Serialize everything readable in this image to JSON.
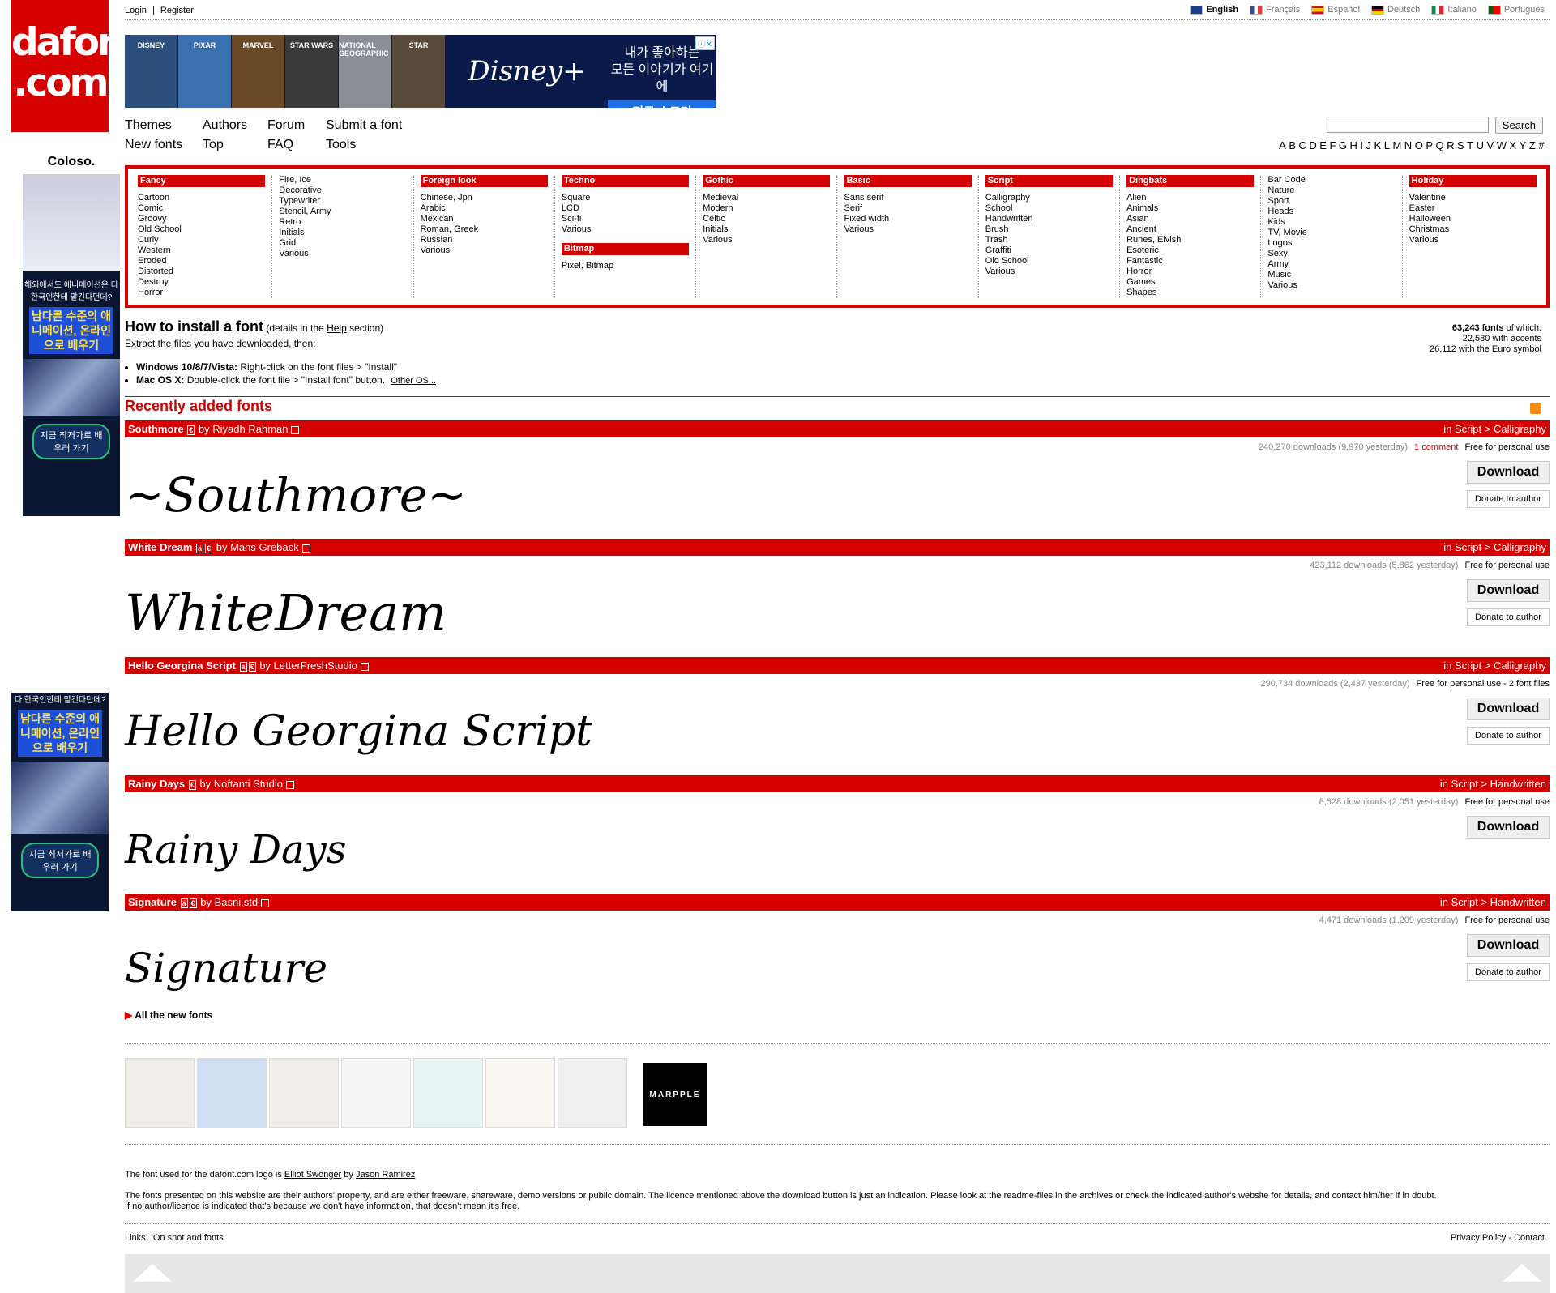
{
  "logo": {
    "line1": "dafont",
    "line2": ".com"
  },
  "top_links": {
    "login": "Login",
    "sep": "|",
    "register": "Register"
  },
  "languages": [
    {
      "label": "English",
      "active": true
    },
    {
      "label": "Français",
      "active": false
    },
    {
      "label": "Español",
      "active": false
    },
    {
      "label": "Deutsch",
      "active": false
    },
    {
      "label": "Italiano",
      "active": false
    },
    {
      "label": "Português",
      "active": false
    }
  ],
  "top_ad": {
    "posters": [
      "DISNEY",
      "PIXAR",
      "MARVEL",
      "STAR WARS",
      "NATIONAL GEOGRAPHIC",
      "STAR"
    ],
    "brand": "Disney+",
    "copy_line1": "내가 좋아하는",
    "copy_line2": "모든 이야기가 여기에",
    "cta": "지금 스트리밍",
    "ad_mark": "ⓘ✕"
  },
  "nav": {
    "themes": "Themes",
    "authors": "Authors",
    "forum": "Forum",
    "submit": "Submit a font",
    "new_fonts": "New fonts",
    "top": "Top",
    "faq": "FAQ",
    "tools": "Tools"
  },
  "search": {
    "button": "Search",
    "placeholder": ""
  },
  "alphabet": [
    "A",
    "B",
    "C",
    "D",
    "E",
    "F",
    "G",
    "H",
    "I",
    "J",
    "K",
    "L",
    "M",
    "N",
    "O",
    "P",
    "Q",
    "R",
    "S",
    "T",
    "U",
    "V",
    "W",
    "X",
    "Y",
    "Z",
    "#"
  ],
  "categories": [
    {
      "header": "Fancy",
      "items": [
        "Cartoon",
        "Comic",
        "Groovy",
        "Old School",
        "Curly",
        "Western",
        "Eroded",
        "Distorted",
        "Destroy",
        "Horror"
      ]
    },
    {
      "header": "",
      "items": [
        "Fire, Ice",
        "Decorative",
        "Typewriter",
        "Stencil, Army",
        "Retro",
        "Initials",
        "Grid",
        "Various"
      ]
    },
    {
      "header": "Foreign look",
      "items": [
        "Chinese, Jpn",
        "Arabic",
        "Mexican",
        "Roman, Greek",
        "Russian",
        "Various"
      ]
    },
    {
      "header": "Techno",
      "items": [
        "Square",
        "LCD",
        "Sci-fi",
        "Various"
      ],
      "sub_header": "Bitmap",
      "sub_items": [
        "Pixel, Bitmap"
      ]
    },
    {
      "header": "Gothic",
      "items": [
        "Medieval",
        "Modern",
        "Celtic",
        "Initials",
        "Various"
      ]
    },
    {
      "header": "Basic",
      "items": [
        "Sans serif",
        "Serif",
        "Fixed width",
        "Various"
      ]
    },
    {
      "header": "Script",
      "items": [
        "Calligraphy",
        "School",
        "Handwritten",
        "Brush",
        "Trash",
        "Graffiti",
        "Old School",
        "Various"
      ]
    },
    {
      "header": "Dingbats",
      "items": [
        "Alien",
        "Animals",
        "Asian",
        "Ancient",
        "Runes, Elvish",
        "Esoteric",
        "Fantastic",
        "Horror",
        "Games",
        "Shapes"
      ]
    },
    {
      "header": "",
      "items": [
        "Bar Code",
        "Nature",
        "Sport",
        "Heads",
        "Kids",
        "TV, Movie",
        "Logos",
        "Sexy",
        "Army",
        "Music",
        "Various"
      ]
    },
    {
      "header": "Holiday",
      "items": [
        "Valentine",
        "Easter",
        "Halloween",
        "Christmas",
        "Various"
      ]
    }
  ],
  "install": {
    "title": "How to install a font",
    "details_pre": "(details in the",
    "help": "Help",
    "details_post": "section)",
    "extract": "Extract the files you have downloaded, then:",
    "win_label": "Windows 10/8/7/Vista:",
    "win_text": "Right-click on the font files > \"Install\"",
    "mac_label": "Mac OS X:",
    "mac_text": "Double-click the font file > \"Install font\" button.",
    "other": "Other OS..."
  },
  "stats": {
    "count": "63,243 fonts",
    "of_which": "of which:",
    "accents": "22,580 with accents",
    "euro": "26,112 with the Euro symbol"
  },
  "recent_title": "Recently added fonts",
  "fonts": [
    {
      "name": "Southmore",
      "tags": [
        "€"
      ],
      "by": "by Riyadh Rahman",
      "category": "in Script > Calligraphy",
      "downloads": "240,270 downloads (9,970 yesterday)",
      "comments": "1 comment",
      "licence": "Free for personal use",
      "download": "Download",
      "donate": "Donate to author",
      "preview": "~Southmore~"
    },
    {
      "name": "White Dream",
      "tags": [
        "ä",
        "€"
      ],
      "by": "by Mans Greback",
      "category": "in Script > Calligraphy",
      "downloads": "423,112 downloads (5,862 yesterday)",
      "comments": "",
      "licence": "Free for personal use",
      "download": "Download",
      "donate": "Donate to author",
      "preview": "WhiteDream"
    },
    {
      "name": "Hello Georgina Script",
      "tags": [
        "ä",
        "€"
      ],
      "by": "by LetterFreshStudio",
      "category": "in Script > Calligraphy",
      "downloads": "290,734 downloads (2,437 yesterday)",
      "comments": "",
      "licence": "Free for personal use - 2 font files",
      "download": "Download",
      "donate": "Donate to author",
      "preview": "Hello Georgina Script"
    },
    {
      "name": "Rainy Days",
      "tags": [
        "€"
      ],
      "by": "by Noftanti Studio",
      "category": "in Script > Handwritten",
      "downloads": "8,528 downloads (2,051 yesterday)",
      "comments": "",
      "licence": "Free for personal use",
      "download": "Download",
      "donate": "",
      "preview": "Rainy Days"
    },
    {
      "name": "Signature",
      "tags": [
        "ä",
        "€"
      ],
      "by": "by Basni.std",
      "category": "in Script > Handwritten",
      "downloads": "4,471 downloads (1,209 yesterday)",
      "comments": "",
      "licence": "Free for personal use",
      "download": "Download",
      "donate": "Donate to author",
      "preview": "Signature"
    }
  ],
  "all_new": "All the new fonts",
  "bottom_ad": {
    "brand": "MARPPLE"
  },
  "footer": {
    "logo_credit_pre": "The font used for the dafont.com logo is",
    "logo_font": "Elliot Swonger",
    "logo_by": "by",
    "logo_author": "Jason Ramirez",
    "disclaimer1": "The fonts presented on this website are their authors' property, and are either freeware, shareware, demo versions or public domain. The licence mentioned above the download button is just an indication. Please look at the readme-files in the archives or check the indicated author's website for details, and contact him/her if in doubt.",
    "disclaimer2": "If no author/licence is indicated that's because we don't have information, that doesn't mean it's free.",
    "links_label": "Links:",
    "links_value": "On snot and fonts",
    "privacy": "Privacy Policy",
    "dash": "-",
    "contact": "Contact"
  },
  "side_ad": {
    "brand": "Coloso.",
    "small": "해외에서도 애니메이션은 다 한국인한테 맡긴다던데?",
    "big": "남다른 수준의 애니메이션, 온라인으로 배우기",
    "cta": "지금 최저가로 배우러 가기",
    "small2": "다 한국인한테 맡긴다던데?"
  }
}
